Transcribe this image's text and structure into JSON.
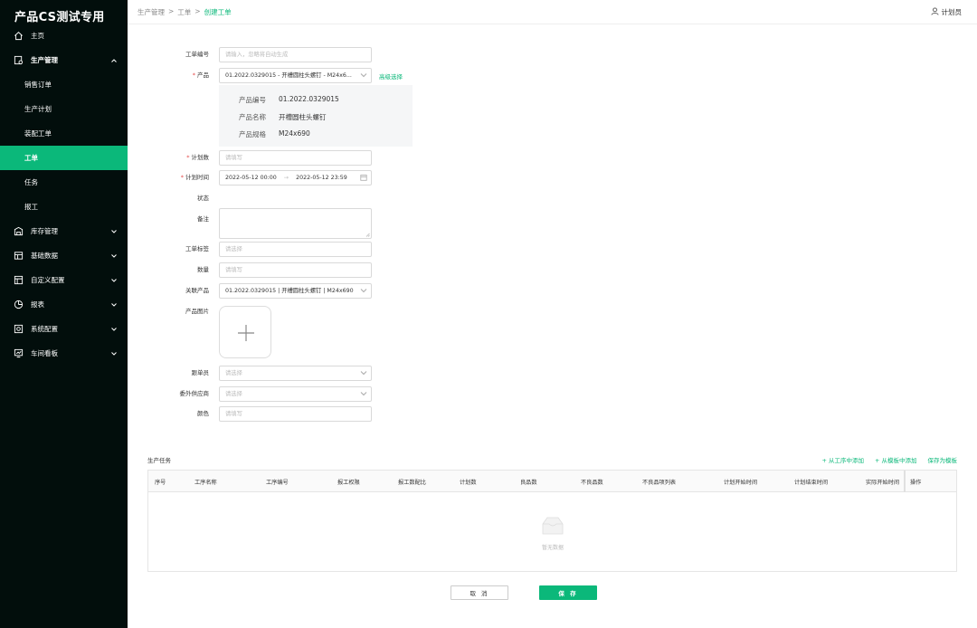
{
  "app": {
    "title": "产品CS测试专用"
  },
  "sidebar": {
    "items": [
      {
        "label": "主页",
        "icon": "home-icon"
      },
      {
        "label": "生产管理",
        "icon": "production-icon",
        "expanded": true
      },
      {
        "label": "销售订单"
      },
      {
        "label": "生产计划"
      },
      {
        "label": "装配工单"
      },
      {
        "label": "工单",
        "active": true
      },
      {
        "label": "任务"
      },
      {
        "label": "报工"
      },
      {
        "label": "库存管理",
        "icon": "warehouse-icon"
      },
      {
        "label": "基础数据",
        "icon": "database-icon"
      },
      {
        "label": "自定义配置",
        "icon": "config-icon"
      },
      {
        "label": "报表",
        "icon": "report-icon"
      },
      {
        "label": "系统配置",
        "icon": "system-icon"
      },
      {
        "label": "车间看板",
        "icon": "dashboard-icon"
      }
    ]
  },
  "header": {
    "breadcrumb": [
      "生产管理",
      ">",
      "工单",
      ">",
      "创建工单"
    ],
    "user": "计划员",
    "user_icon": "user-icon"
  },
  "form": {
    "order_no": {
      "label": "工单编号",
      "placeholder": "请输入，忽略将自动生成"
    },
    "product": {
      "label": "产品",
      "value": "01.2022.0329015 - 开槽圆柱头螺钉 - M24x6...",
      "advanced": "高级选择"
    },
    "product_info": {
      "code_label": "产品编号",
      "code": "01.2022.0329015",
      "name_label": "产品名称",
      "name": "开槽圆柱头螺钉",
      "spec_label": "产品规格",
      "spec": "M24x690"
    },
    "plan_qty": {
      "label": "计划数",
      "placeholder": "请填写"
    },
    "plan_time": {
      "label": "计划时间",
      "start": "2022-05-12 00:00",
      "sep": "→",
      "end": "2022-05-12 23:59"
    },
    "status": {
      "label": "状态"
    },
    "remark": {
      "label": "备注"
    },
    "tag": {
      "label": "工单标签",
      "placeholder": "请选择"
    },
    "quantity": {
      "label": "数量",
      "placeholder": "请填写"
    },
    "related_product": {
      "label": "关联产品",
      "value": "01.2022.0329015 | 开槽圆柱头螺钉 | M24x690"
    },
    "image": {
      "label": "产品图片"
    },
    "follower": {
      "label": "跟单员",
      "placeholder": "请选择"
    },
    "supplier": {
      "label": "委外供应商",
      "placeholder": "请选择"
    },
    "color": {
      "label": "颜色",
      "placeholder": "请填写"
    }
  },
  "tasks": {
    "title": "生产任务",
    "actions": [
      "从工序中添加",
      "从模板中添加",
      "保存为模板"
    ],
    "columns": [
      "序号",
      "工序名称",
      "工序编号",
      "报工权限",
      "报工数配比",
      "计划数",
      "良品数",
      "不良品数",
      "不良品项列表",
      "计划开始时间",
      "计划结束时间",
      "实际开始时间",
      "操作"
    ],
    "empty_text": "暂无数据"
  },
  "footer": {
    "cancel": "取 消",
    "save": "保 存"
  },
  "colors": {
    "accent": "#0bb87a",
    "sidebar_bg": "#020e0c",
    "required": "#e54b4b"
  }
}
